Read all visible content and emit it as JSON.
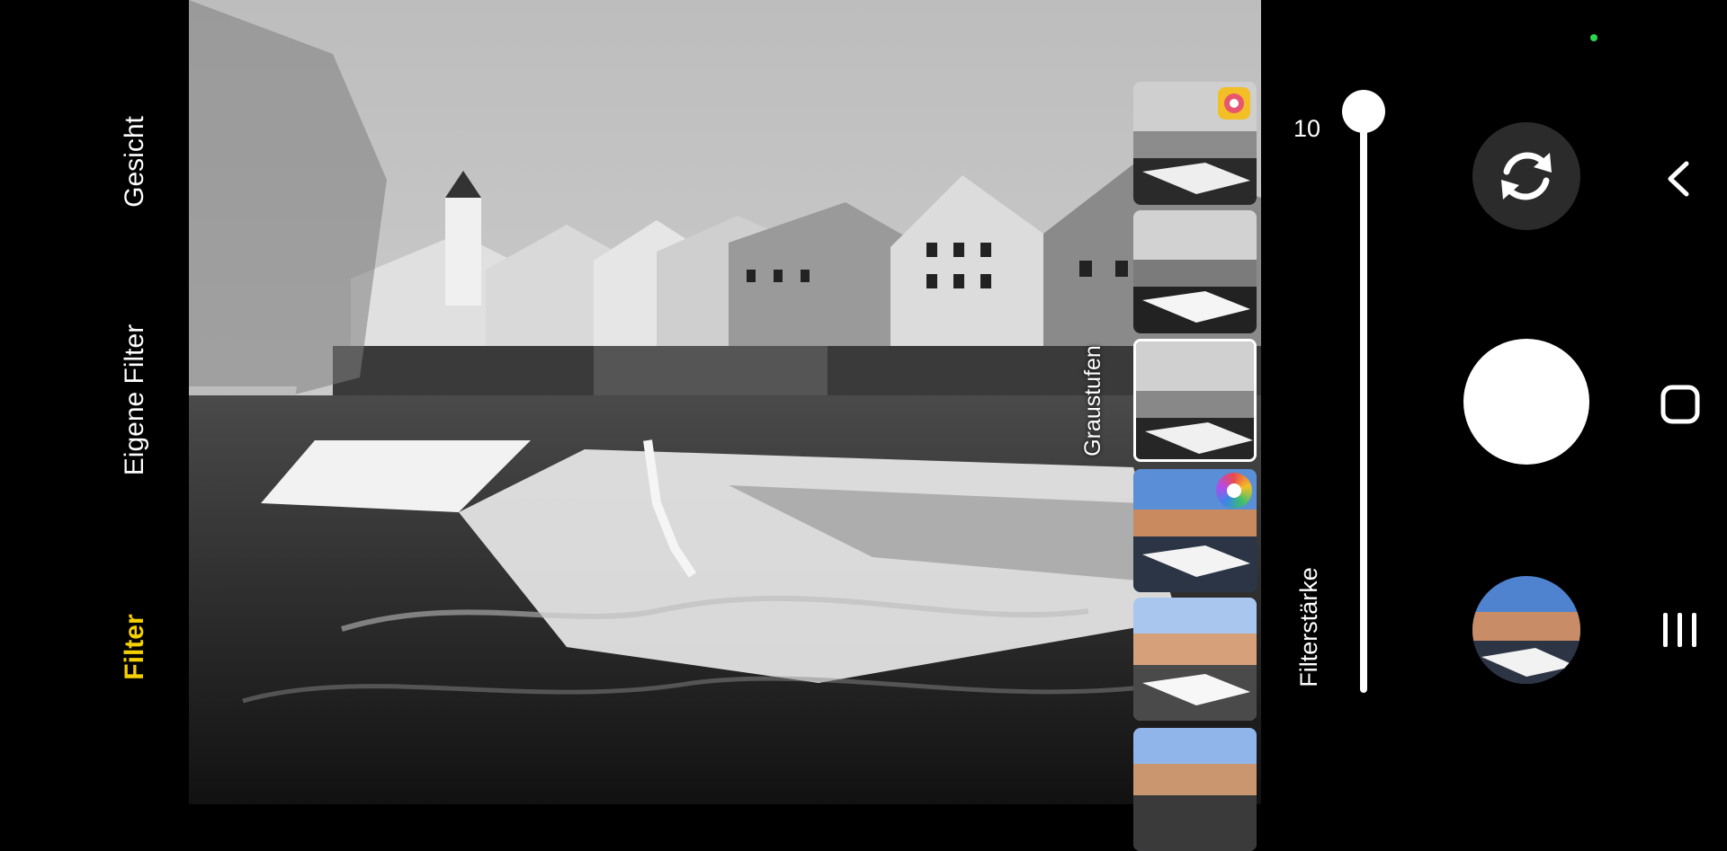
{
  "modes": {
    "face": "Gesicht",
    "own_filter": "Eigene Filter",
    "filter": "Filter"
  },
  "filter_strip": {
    "selected_label": "Graustufen"
  },
  "slider": {
    "value": "10",
    "label": "Filterstärke",
    "level_percent": 100
  },
  "colors": {
    "active_mode": "#f5d000",
    "status_dot": "#2bd84d"
  },
  "icons": {
    "switch_camera": "switch-camera-icon",
    "back": "back-icon",
    "home": "home-icon",
    "recents": "recents-icon"
  }
}
